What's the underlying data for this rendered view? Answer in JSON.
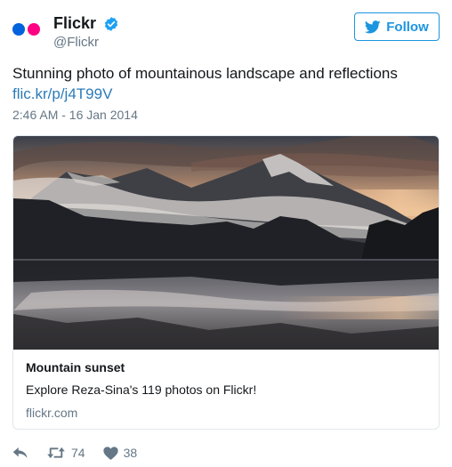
{
  "account": {
    "display_name": "Flickr",
    "handle": "@Flickr",
    "verified": true
  },
  "follow_button": {
    "label": "Follow",
    "icon": "twitter-bird-icon"
  },
  "tweet": {
    "text": "Stunning photo of mountainous landscape and reflections",
    "link": "flic.kr/p/j4T99V",
    "timestamp": "2:46 AM - 16 Jan 2014"
  },
  "card": {
    "image": "mountain-sunset-lake-reflection-photo",
    "title": "Mountain sunset",
    "description": "Explore Reza-Sina's 119 photos on Flickr!",
    "domain": "flickr.com"
  },
  "actions": {
    "reply": {
      "icon": "reply-icon"
    },
    "retweet": {
      "icon": "retweet-icon",
      "count": "74"
    },
    "like": {
      "icon": "heart-icon",
      "count": "38"
    }
  },
  "colors": {
    "twitter_blue": "#1b95e0",
    "link": "#2b7bb9",
    "muted": "#657786",
    "flickr_blue": "#0063dc",
    "flickr_pink": "#ff0084"
  }
}
